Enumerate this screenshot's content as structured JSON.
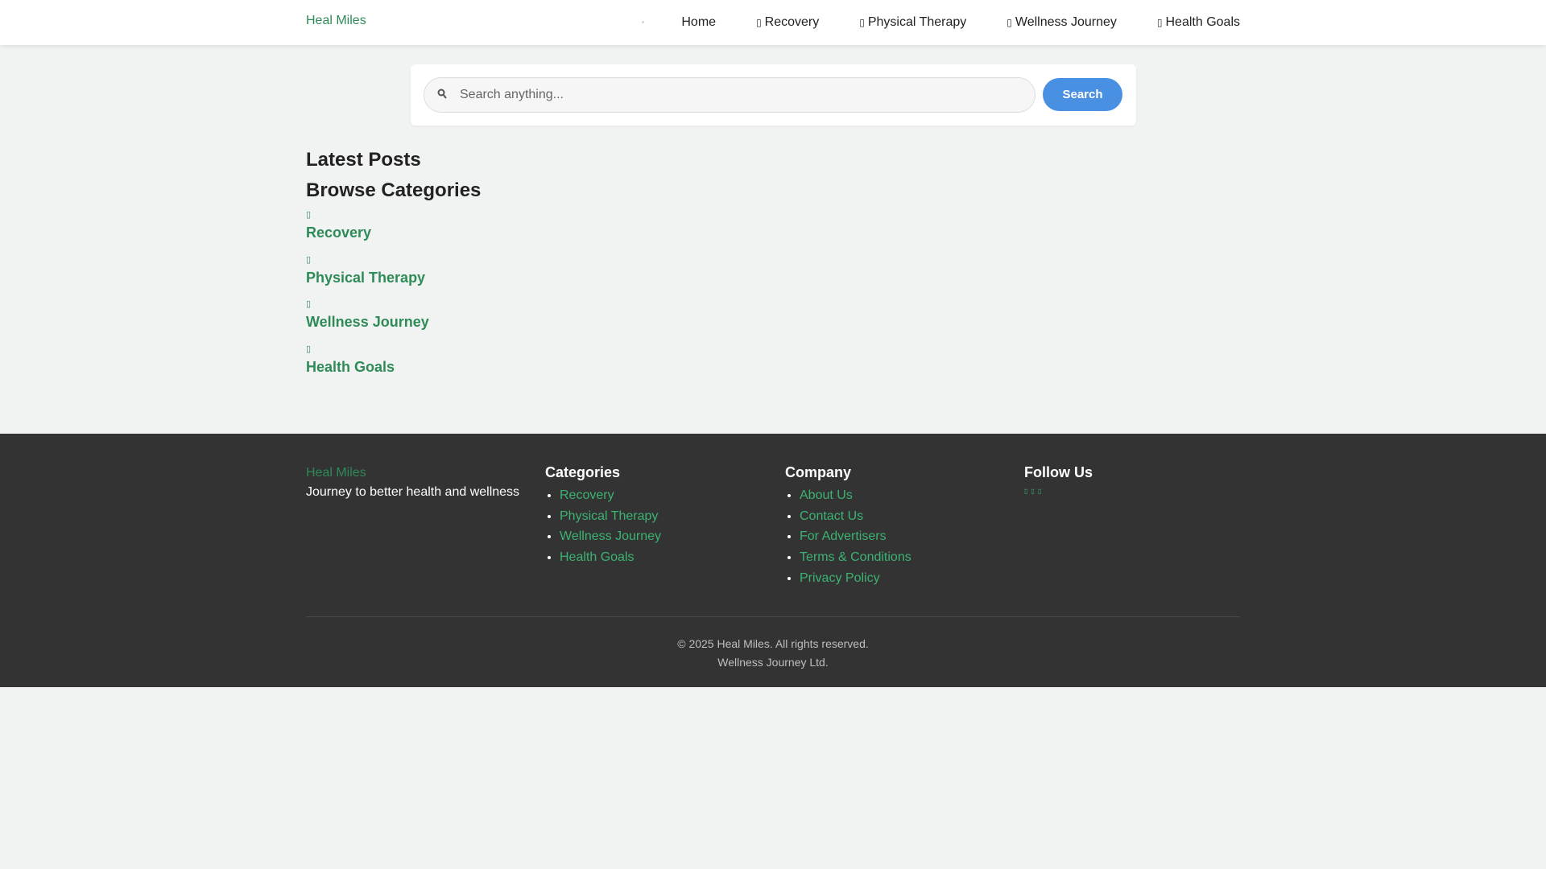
{
  "header": {
    "brand": "Heal Miles",
    "nav": [
      {
        "label": "Home",
        "icon": ""
      },
      {
        "label": "Recovery",
        "icon": "recovery-icon"
      },
      {
        "label": "Physical Therapy",
        "icon": "physical-therapy-icon"
      },
      {
        "label": "Wellness Journey",
        "icon": "wellness-journey-icon"
      },
      {
        "label": "Health Goals",
        "icon": "health-goals-icon"
      }
    ]
  },
  "search": {
    "placeholder": "Search anything...",
    "button": "Search",
    "icon": "search-icon"
  },
  "main": {
    "latest_title": "Latest Posts",
    "categories_title": "Browse Categories",
    "categories": [
      {
        "label": "Recovery"
      },
      {
        "label": "Physical Therapy"
      },
      {
        "label": "Wellness Journey"
      },
      {
        "label": "Health Goals"
      }
    ]
  },
  "footer": {
    "brand": "Heal Miles",
    "tagline": "Journey to better health and wellness",
    "categories_heading": "Categories",
    "categories": [
      "Recovery",
      "Physical Therapy",
      "Wellness Journey",
      "Health Goals"
    ],
    "company_heading": "Company",
    "company": [
      "About Us",
      "Contact Us",
      "For Advertisers",
      "Terms & Conditions",
      "Privacy Policy"
    ],
    "follow_heading": "Follow Us",
    "social_icons": [
      "facebook-icon",
      "twitter-icon",
      "instagram-icon"
    ],
    "copyright": "© 2025 Heal Miles. All rights reserved.",
    "company_name": "Wellness Journey Ltd."
  },
  "colors": {
    "accent_green": "#2e8b57",
    "button_blue": "#4a90e2",
    "footer_bg": "#333333",
    "page_bg": "#f1f3f2"
  }
}
